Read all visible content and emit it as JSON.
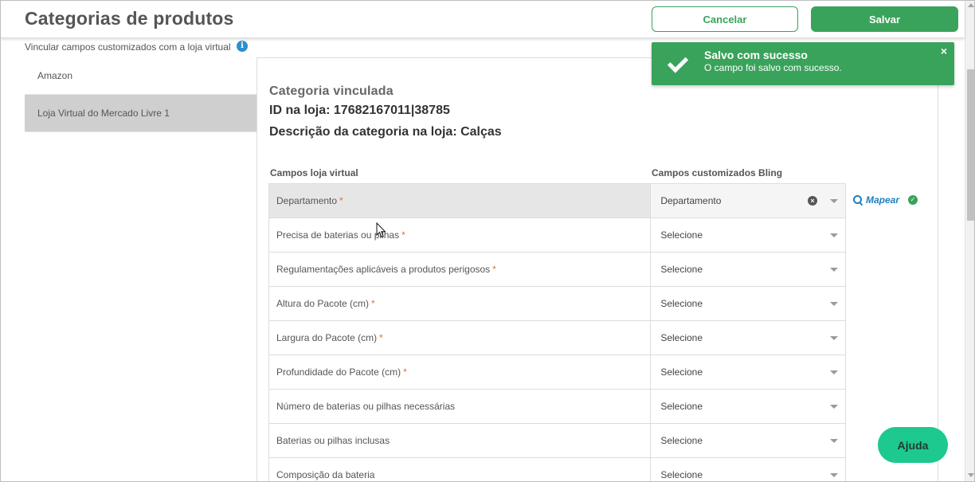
{
  "header": {
    "title": "Categorias de produtos",
    "cancel_label": "Cancelar",
    "save_label": "Salvar"
  },
  "link_section": {
    "label": "Vincular campos customizados com a loja virtual",
    "info_icon": "info-icon"
  },
  "stores": [
    {
      "label": "Amazon",
      "active": false
    },
    {
      "label": "Loja Virtual do Mercado Livre 1",
      "active": true
    }
  ],
  "category": {
    "title": "Categoria vinculada",
    "id_line": "ID na loja: 17682167011|38785",
    "desc_line": "Descrição da categoria na loja: Calças"
  },
  "table": {
    "col_left": "Campos loja virtual",
    "col_right": "Campos customizados Bling",
    "required_marker": "*",
    "rows": [
      {
        "field": "Departamento",
        "required": true,
        "value": "Departamento"
      },
      {
        "field": "Precisa de baterias ou pilhas",
        "required": true,
        "value": "Selecione"
      },
      {
        "field": "Regulamentações aplicáveis a produtos perigosos",
        "required": true,
        "value": "Selecione"
      },
      {
        "field": "Altura do Pacote (cm)",
        "required": true,
        "value": "Selecione"
      },
      {
        "field": "Largura do Pacote (cm)",
        "required": true,
        "value": "Selecione"
      },
      {
        "field": "Profundidade do Pacote (cm)",
        "required": true,
        "value": "Selecione"
      },
      {
        "field": "Número de baterias ou pilhas necessárias",
        "required": false,
        "value": "Selecione"
      },
      {
        "field": "Baterias ou pilhas inclusas",
        "required": false,
        "value": "Selecione"
      },
      {
        "field": "Composição da bateria",
        "required": false,
        "value": "Selecione"
      }
    ]
  },
  "map_link": {
    "label": "Mapear",
    "icon": "search-icon",
    "status_icon": "check-circle-icon"
  },
  "toast": {
    "title": "Salvo com sucesso",
    "message": "O campo foi salvo com sucesso.",
    "close_symbol": "×"
  },
  "help": {
    "label": "Ajuda"
  },
  "colors": {
    "accent_green": "#3aa35b",
    "help_green": "#1dc98e",
    "link_blue": "#1f7fbf",
    "required_orange": "#e0703a"
  }
}
